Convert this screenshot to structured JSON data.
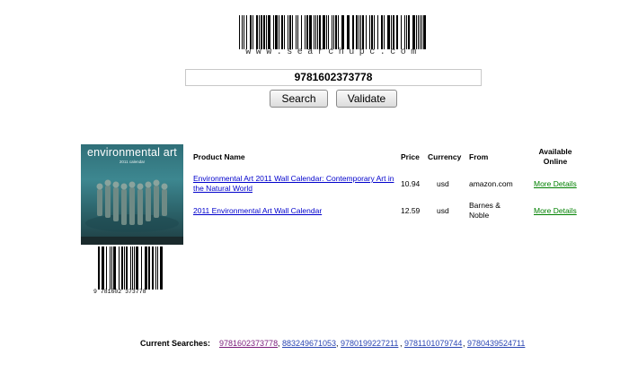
{
  "logo": {
    "text": "www.searchupc.com"
  },
  "search": {
    "value": "9781602373778",
    "search_label": "Search",
    "validate_label": "Validate"
  },
  "product": {
    "cover_title": "environmental art",
    "cover_subtitle": "2011 calendar",
    "barcode_number": "9  781602   373778"
  },
  "table": {
    "headers": {
      "name": "Product Name",
      "price": "Price",
      "currency": "Currency",
      "from": "From",
      "available_line1": "Available",
      "available_line2": "Online"
    },
    "rows": [
      {
        "name": "Environmental Art 2011 Wall Calendar: Contemporary Art in the Natural World",
        "price": "10.94",
        "currency": "usd",
        "from": "amazon.com",
        "link": "More Details"
      },
      {
        "name": "2011 Environmental Art Wall Calendar",
        "price": "12.59",
        "currency": "usd",
        "from": "Barnes & Noble",
        "link": "More Details"
      }
    ]
  },
  "footer": {
    "label": "Current Searches:",
    "searches": [
      "9781602373778",
      "883249671053",
      "9780199227211",
      "9781101079744",
      "9780439524711"
    ]
  },
  "colors": {
    "link": "#0000cc",
    "visited": "#7a1b7a",
    "details": "#008000"
  }
}
